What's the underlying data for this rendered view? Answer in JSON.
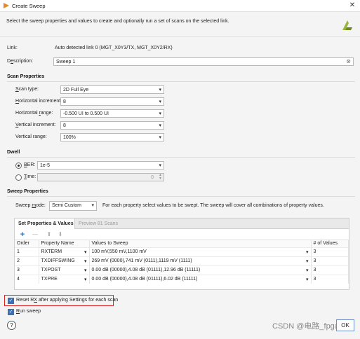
{
  "window": {
    "title": "Create Sweep",
    "close_glyph": "✕"
  },
  "header": {
    "description": "Select the sweep properties and values to create and optionally run a set of scans on the selected link."
  },
  "link": {
    "label": "Link:",
    "value": "Auto detected link 0 (MGT_X0Y3/TX, MGT_X0Y2/RX)"
  },
  "description_field": {
    "label_pre": "D",
    "label_u": "e",
    "label_post": "scription:",
    "value": "Sweep 1",
    "clear_glyph": "⊗"
  },
  "scan_properties": {
    "title": "Scan Properties",
    "rows": [
      {
        "label_pre": "",
        "label_u": "S",
        "label_post": "can type:",
        "value": "2D Full Eye"
      },
      {
        "label_pre": "",
        "label_u": "H",
        "label_post": "orizontal increment:",
        "value": "8"
      },
      {
        "label_pre": "Horizontal ",
        "label_u": "r",
        "label_post": "ange:",
        "value": "-0.500 UI to 0.500 UI"
      },
      {
        "label_pre": "",
        "label_u": "V",
        "label_post": "ertical increment:",
        "value": "8"
      },
      {
        "label_pre": "Vertical range",
        "label_u": "",
        "label_post": ":",
        "value": "100%"
      }
    ]
  },
  "dwell": {
    "title": "Dwell",
    "ber": {
      "label_pre": "",
      "label_u": "B",
      "label_post": "ER:",
      "value": "1e-5",
      "selected": true
    },
    "time": {
      "label_pre": "",
      "label_u": "T",
      "label_post": "ime:",
      "value": "0",
      "selected": false
    }
  },
  "sweep_properties": {
    "title": "Sweep Properties",
    "mode_label_pre": "Sweep ",
    "mode_label_u": "m",
    "mode_label_post": "ode:",
    "mode_value": "Semi Custom",
    "mode_hint": "For each property select values to be swept. The sweep will cover all combinations of property values.",
    "tabs": [
      "Set Properties & Values",
      "Preview 81 Scans"
    ],
    "toolbar": {
      "add": "+",
      "remove": "—",
      "up": "⬆",
      "down": "⬇"
    },
    "columns": [
      "Order",
      "Property Name",
      "Values to Sweep",
      "# of Values"
    ],
    "rows": [
      {
        "order": "1",
        "property": "RXTERM",
        "values": "100 mV,550 mV,1100 mV",
        "count": "3"
      },
      {
        "order": "2",
        "property": "TXDIFFSWING",
        "values": "269 mV (0000),741 mV (0111),1119 mV (1111)",
        "count": "3"
      },
      {
        "order": "3",
        "property": "TXPOST",
        "values": "0.00 dB (00000),4.08 dB (01111),12.96 dB (11111)",
        "count": "3"
      },
      {
        "order": "4",
        "property": "TXPRE",
        "values": "0.00 dB (00000),4.08 dB (01111),6.02 dB (11111)",
        "count": "3"
      }
    ]
  },
  "options": {
    "reset_rx": {
      "label_pre": "Reset R",
      "label_u": "X",
      "label_post": " after applying Settings for each scan",
      "checked": true
    },
    "run_sweep": {
      "label_pre": "",
      "label_u": "R",
      "label_post": "un sweep",
      "checked": true
    }
  },
  "footer": {
    "help": "?",
    "watermark": "CSDN @电路_fpga",
    "ok_label": "OK"
  },
  "icons": {
    "app": "vivado-logo-icon",
    "brand": "xilinx-logo-icon",
    "chevron": "▾"
  },
  "colors": {
    "highlight": "#e02424",
    "accent": "#3c6fb5"
  }
}
